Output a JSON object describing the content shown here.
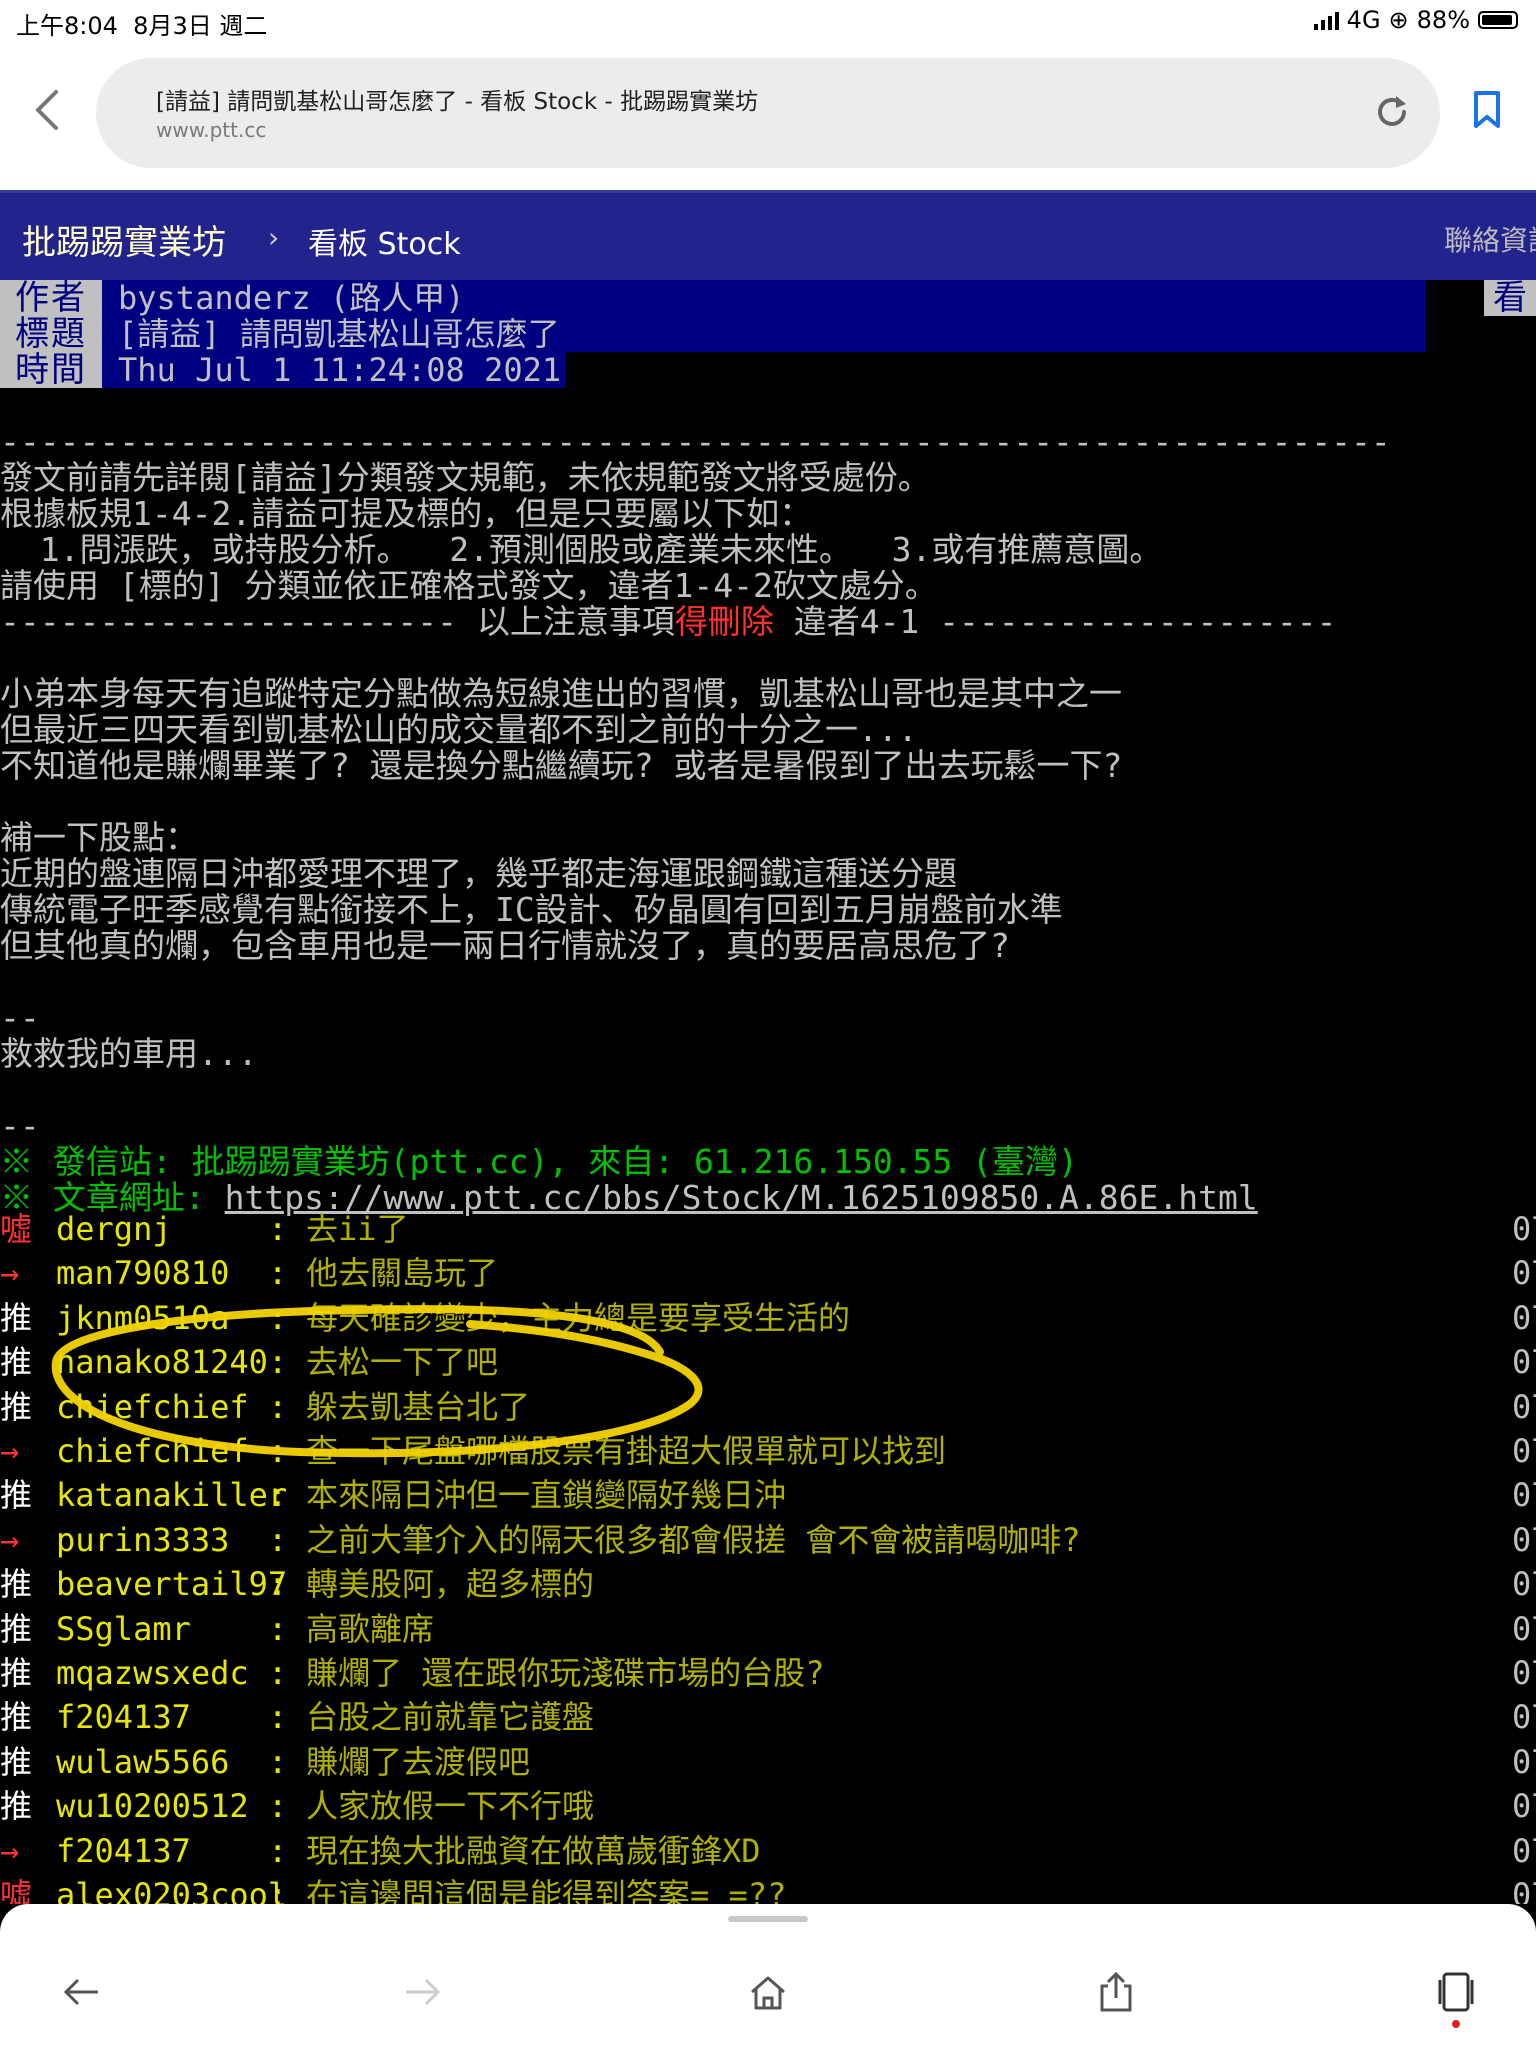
{
  "status_bar": {
    "time": "上午8:04",
    "date": "8月3日 週二",
    "network": "4G",
    "battery": "88%"
  },
  "browser": {
    "page_title": "[請益] 請問凱基松山哥怎麼了 - 看板 Stock - 批踢踢實業坊",
    "domain": "www.ptt.cc"
  },
  "site_header": {
    "brand": "批踢踢實業坊",
    "separator": "›",
    "board": "看板 Stock",
    "contact": "聯絡資訊"
  },
  "article_header": {
    "author_label": "作者",
    "author": "bystanderz (路人甲)",
    "title_label": "標題",
    "title": "[請益] 請問凱基松山哥怎麼了",
    "time_label": "時間",
    "time": "Thu Jul  1 11:24:08 2021",
    "view_button": "看"
  },
  "body": {
    "rule1": "----------------------------------------------------------------------",
    "notice_lines": [
      "發文前請先詳閱[請益]分類發文規範，未依規範發文將受處份。",
      "根據板規1-4-2.請益可提及標的，但是只要屬以下如：",
      "  1.問漲跌，或持股分析。  2.預測個股或產業未來性。  3.或有推薦意圖。",
      "請使用 [標的] 分類並依正確格式發文，違者1-4-2砍文處分。"
    ],
    "notice_footer_pre": "----------------------- 以上注意事項",
    "notice_footer_red": "得刪除",
    "notice_footer_post": " 違者4-1 --------------------",
    "para1": [
      "小弟本身每天有追蹤特定分點做為短線進出的習慣，凱基松山哥也是其中之一",
      "但最近三四天看到凱基松山的成交量都不到之前的十分之一...",
      "不知道他是賺爛畢業了? 還是換分點繼續玩? 或者是暑假到了出去玩鬆一下?"
    ],
    "para2": [
      "補一下股點：",
      "近期的盤連隔日沖都愛理不理了，幾乎都走海運跟鋼鐵這種送分題",
      "傳統電子旺季感覺有點銜接不上，IC設計、矽晶圓有回到五月崩盤前水準",
      "但其他真的爛，包含車用也是一兩日行情就沒了，真的要居高思危了?"
    ],
    "sig_sep1": "--",
    "signature": "救救我的車用...",
    "sig_sep2": "--",
    "origin": "※ 發信站: 批踢踢實業坊(ptt.cc), 來自: 61.216.150.55 (臺灣)",
    "url_label": "※ 文章網址: ",
    "url": "https://www.ptt.cc/bbs/Stock/M.1625109850.A.86E.html"
  },
  "pushes": [
    {
      "tag": "噓",
      "kind": "boo",
      "user": "dergnj",
      "msg": "去ii了"
    },
    {
      "tag": "→",
      "kind": "arrow",
      "user": "man790810",
      "msg": "他去關島玩了"
    },
    {
      "tag": "推",
      "kind": "push",
      "user": "jknm0510a",
      "msg": "每天確診變少，主力總是要享受生活的"
    },
    {
      "tag": "推",
      "kind": "push",
      "user": "nanako81240",
      "msg": "去松一下了吧"
    },
    {
      "tag": "推",
      "kind": "push",
      "user": "chiefchief",
      "msg": "躲去凱基台北了"
    },
    {
      "tag": "→",
      "kind": "arrow",
      "user": "chiefchief",
      "msg": "查一下尾盤哪檔股票有掛超大假單就可以找到"
    },
    {
      "tag": "推",
      "kind": "push",
      "user": "katanakiller",
      "msg": "本來隔日沖但一直鎖變隔好幾日沖"
    },
    {
      "tag": "→",
      "kind": "arrow",
      "user": "purin3333",
      "msg": "之前大筆介入的隔天很多都會假搓 會不會被請喝咖啡?"
    },
    {
      "tag": "推",
      "kind": "push",
      "user": "beavertail97",
      "msg": "轉美股阿，超多標的"
    },
    {
      "tag": "推",
      "kind": "push",
      "user": "SSglamr",
      "msg": "高歌離席"
    },
    {
      "tag": "推",
      "kind": "push",
      "user": "mqazwsxedc",
      "msg": "賺爛了 還在跟你玩淺碟市場的台股?"
    },
    {
      "tag": "推",
      "kind": "push",
      "user": "f204137",
      "msg": "台股之前就靠它護盤"
    },
    {
      "tag": "推",
      "kind": "push",
      "user": "wulaw5566",
      "msg": "賺爛了去渡假吧"
    },
    {
      "tag": "推",
      "kind": "push",
      "user": "wu10200512",
      "msg": "人家放假一下不行哦"
    },
    {
      "tag": "→",
      "kind": "arrow",
      "user": "f204137",
      "msg": "現在換大批融資在做萬歲衝鋒XD"
    },
    {
      "tag": "噓",
      "kind": "boo",
      "user": "alex0203cool",
      "msg": "在這邊問這個是能得到答案= =??"
    }
  ],
  "push_ts_fragment": "07",
  "icons": {
    "back": "chevron-left-icon",
    "reload": "reload-icon",
    "bookmark": "bookmark-icon",
    "nav_back": "arrow-left-icon",
    "nav_forward": "arrow-right-icon",
    "home": "home-icon",
    "share": "share-icon",
    "tabs": "tabs-icon"
  },
  "colors": {
    "site_header": "#23238e",
    "header_value_bg": "#000080",
    "push_user": "#e6e600",
    "annotation": "#f5d400"
  }
}
